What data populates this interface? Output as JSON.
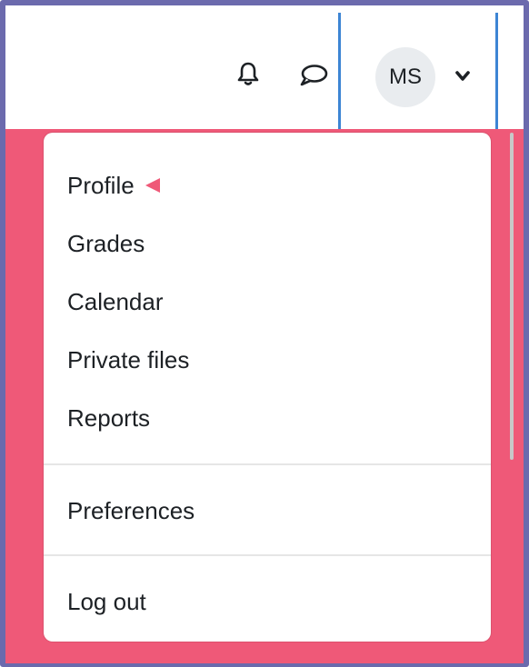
{
  "colors": {
    "frame_border": "#6b6aad",
    "focus_outline": "#3d85d4",
    "backdrop": "#ef5978",
    "pointer_arrow": "#ef5978",
    "avatar_bg": "#e9ecef",
    "text": "#1d2125"
  },
  "header": {
    "notifications_icon": "bell-icon",
    "messages_icon": "speech-bubble-icon",
    "user_menu": {
      "initials": "MS",
      "caret_icon": "chevron-down-icon"
    }
  },
  "dropdown": {
    "items": [
      {
        "label": "Profile",
        "highlighted": true
      },
      {
        "label": "Grades"
      },
      {
        "label": "Calendar"
      },
      {
        "label": "Private files"
      },
      {
        "label": "Reports"
      },
      {
        "label": "Preferences"
      },
      {
        "label": "Log out"
      }
    ]
  }
}
